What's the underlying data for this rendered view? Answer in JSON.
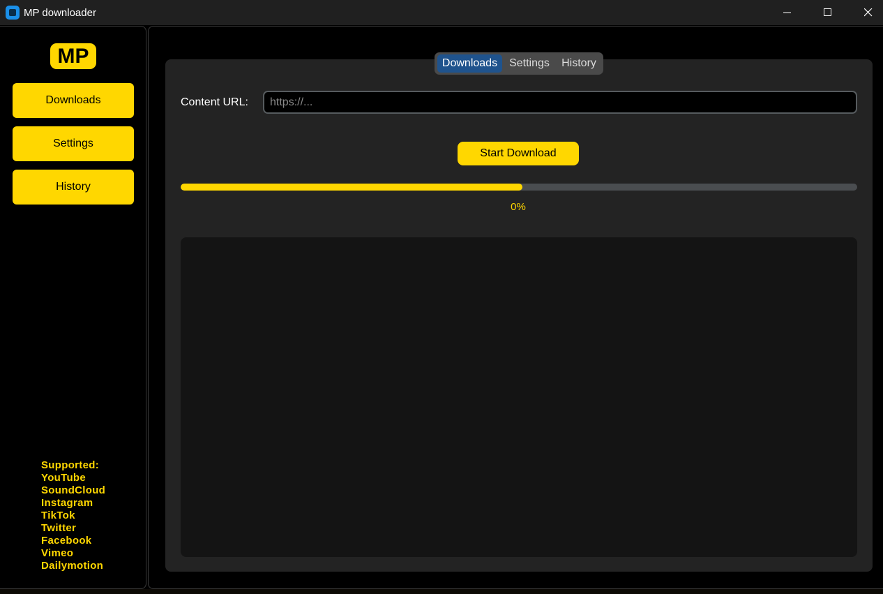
{
  "window": {
    "title": "MP downloader",
    "icon": "app-icon"
  },
  "sidebar": {
    "logo": "MP",
    "buttons": [
      "Downloads",
      "Settings",
      "History"
    ],
    "supported": [
      "Supported:",
      "YouTube",
      "SoundCloud",
      "Instagram",
      "TikTok",
      "Twitter",
      "Facebook",
      "Vimeo",
      "Dailymotion"
    ]
  },
  "tabs": {
    "items": [
      "Downloads",
      "Settings",
      "History"
    ],
    "selected": "Downloads"
  },
  "form": {
    "url_label": "Content URL:",
    "url_value": "",
    "url_placeholder": "https://...",
    "start_label": "Start Download"
  },
  "progress": {
    "fraction": 0.505,
    "text": "0%"
  },
  "colors": {
    "accent": "#ffd700",
    "tab_selected": "#1f538d",
    "panel": "#232323",
    "log_background": "#141414"
  }
}
